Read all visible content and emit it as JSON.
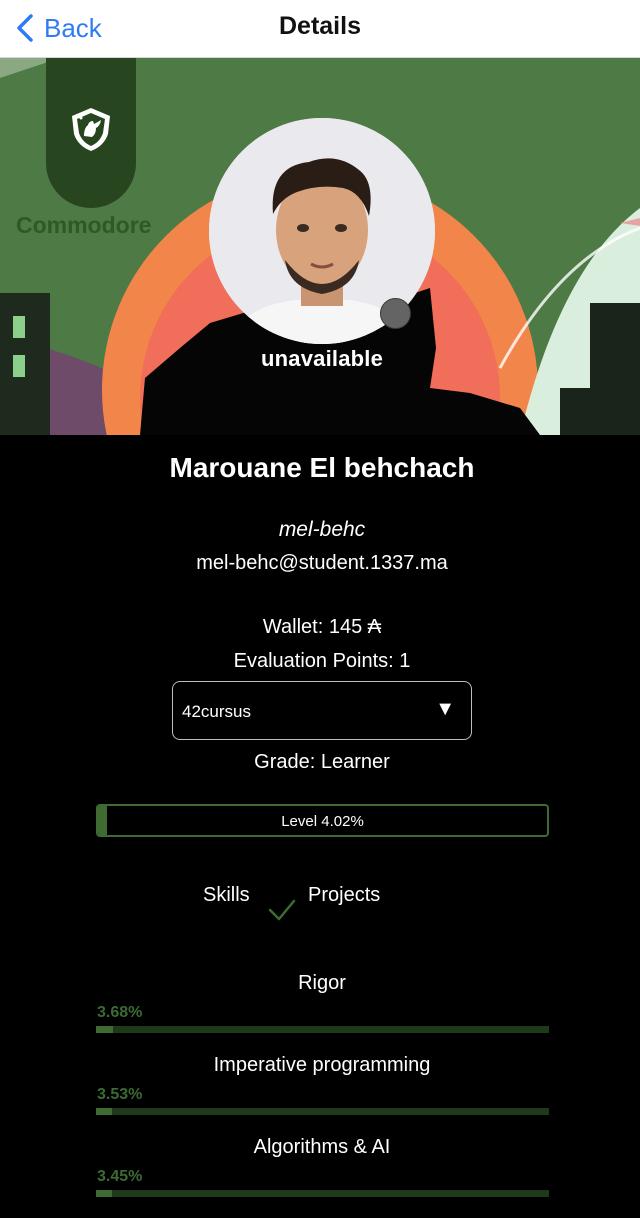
{
  "nav": {
    "back_label": "Back",
    "title": "Details"
  },
  "coalition": {
    "name": "Commodore",
    "color": "#27461f"
  },
  "profile": {
    "status": "unavailable",
    "full_name": "Marouane El behchach",
    "login": "mel-behc",
    "email": "mel-behc@student.1337.ma",
    "wallet": "Wallet: 145 ₳",
    "evaluation_points": "Evaluation Points: 1"
  },
  "cursus": {
    "selected": "42cursus",
    "arrow": "▼"
  },
  "grade": "Grade: Learner",
  "level": {
    "label": "Level 4.02%",
    "fill_fraction": 0.02
  },
  "tabs": {
    "skills": "Skills",
    "projects": "Projects"
  },
  "skills": [
    {
      "name": "Rigor",
      "percent": "3.68%",
      "fraction": 0.0368
    },
    {
      "name": "Imperative programming",
      "percent": "3.53%",
      "fraction": 0.0353
    },
    {
      "name": "Algorithms & AI",
      "percent": "3.45%",
      "fraction": 0.0345
    }
  ],
  "colors": {
    "accent_green": "#3f6b32",
    "ios_blue": "#2f7bf5"
  }
}
